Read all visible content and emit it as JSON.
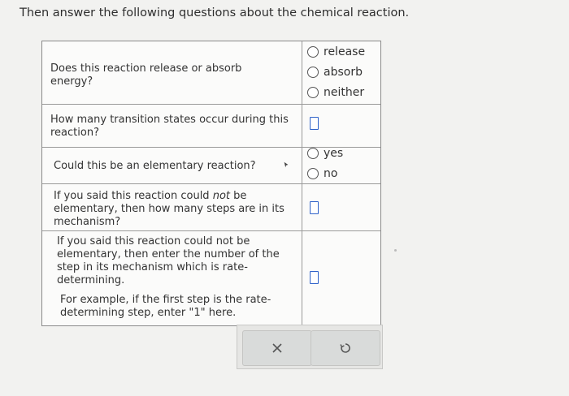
{
  "intro": "Then answer the following questions about the chemical reaction.",
  "questions": [
    {
      "text": "Does this reaction release or absorb energy?",
      "options": [
        "release",
        "absorb",
        "neither"
      ]
    },
    {
      "text": "How many transition states occur during this reaction?",
      "input_value": ""
    },
    {
      "text": "Could this be an elementary reaction?",
      "options": [
        "yes",
        "no"
      ]
    },
    {
      "text_before": "If you said this reaction could ",
      "text_emph": "not",
      "text_after": " be elementary, then how many steps are in its mechanism?",
      "input_value": ""
    },
    {
      "text": "If you said this reaction could not be elementary, then enter the number of the step in its mechanism which is rate-determining.",
      "example": "For example, if the first step is the rate-determining step, enter \"1\" here.",
      "input_value": ""
    }
  ],
  "buttons": {
    "clear_icon": "x-icon",
    "reset_icon": "undo-icon"
  },
  "colors": {
    "input_border": "#2f62c9",
    "background": "#f2f2f0"
  }
}
